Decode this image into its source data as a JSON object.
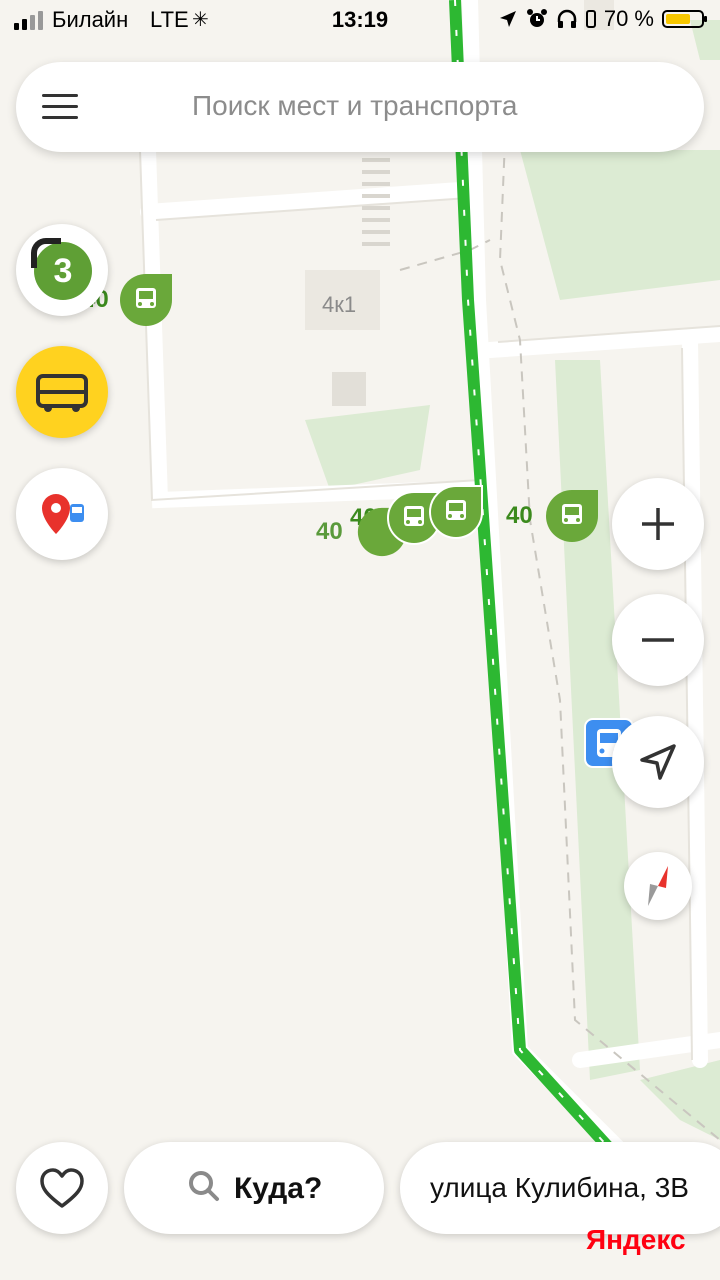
{
  "status_bar": {
    "carrier": "Билайн",
    "network": "LTE",
    "time": "13:19",
    "battery_percent": "70 %",
    "battery_level": 0.7
  },
  "search": {
    "placeholder": "Поиск мест и транспорта"
  },
  "layers": {
    "badge": "3"
  },
  "map": {
    "building_label": "4к1",
    "route_labels": [
      "40",
      "40",
      "40",
      "40"
    ],
    "route_color": "#2db832",
    "stop_color": "#6aa83a"
  },
  "bottom": {
    "where_label": "Куда?",
    "address": "улица Кулибина, 3В",
    "brand": "Яндекс"
  }
}
